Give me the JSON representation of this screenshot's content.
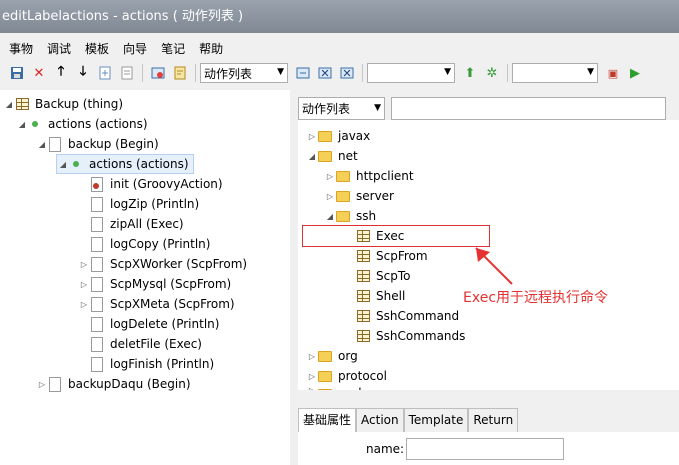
{
  "window": {
    "title": "editLabelactions - actions ( 动作列表 )"
  },
  "menu": [
    "事物",
    "调试",
    "模板",
    "向导",
    "笔记",
    "帮助"
  ],
  "toolbar": {
    "icons": [
      "save-icon",
      "delete-icon",
      "move-up-icon",
      "move-down-icon",
      "import-icon",
      "export-icon",
      "refresh-icon",
      "note-icon",
      "edit-icon",
      "remove-icon",
      "browse-icon",
      "run-icon",
      "debug-icon",
      "play-icon"
    ],
    "combo1_value": "动作列表",
    "combo2_value": "",
    "combo3_value": ""
  },
  "left_tree": [
    {
      "label": "Backup (thing)",
      "icon": "table-icon",
      "expanded": true
    },
    {
      "label": "actions (actions)",
      "icon": "status-dot-icon",
      "expanded": true
    },
    {
      "label": "backup (Begin)",
      "icon": "document-icon",
      "expanded": true
    },
    {
      "label": "actions (actions)",
      "icon": "status-dot-icon",
      "expanded": true,
      "selected": true
    },
    {
      "label": "init (GroovyAction)",
      "icon": "script-icon"
    },
    {
      "label": "logZip (Println)",
      "icon": "document-icon"
    },
    {
      "label": "zipAll (Exec)",
      "icon": "document-icon"
    },
    {
      "label": "logCopy (Println)",
      "icon": "document-icon"
    },
    {
      "label": "ScpXWorker (ScpFrom)",
      "icon": "document-icon",
      "expandable": true
    },
    {
      "label": "ScpMysql (ScpFrom)",
      "icon": "document-icon",
      "expandable": true
    },
    {
      "label": "ScpXMeta (ScpFrom)",
      "icon": "document-icon",
      "expandable": true
    },
    {
      "label": "logDelete (Println)",
      "icon": "document-icon"
    },
    {
      "label": "deletFile (Exec)",
      "icon": "document-icon"
    },
    {
      "label": "logFinish (Println)",
      "icon": "document-icon"
    },
    {
      "label": "backupDaqu (Begin)",
      "icon": "document-icon",
      "expandable": true
    }
  ],
  "right_panel": {
    "combo_value": "动作列表",
    "search_value": "",
    "tree": [
      {
        "label": "javax",
        "icon": "folder-icon",
        "expandable": true
      },
      {
        "label": "net",
        "icon": "folder-icon",
        "expanded": true
      },
      {
        "label": "httpclient",
        "icon": "folder-icon",
        "expandable": true
      },
      {
        "label": "server",
        "icon": "folder-icon",
        "expandable": true
      },
      {
        "label": "ssh",
        "icon": "folder-icon",
        "expanded": true
      },
      {
        "label": "Exec",
        "icon": "table-icon",
        "highlighted": true
      },
      {
        "label": "ScpFrom",
        "icon": "table-icon"
      },
      {
        "label": "ScpTo",
        "icon": "table-icon"
      },
      {
        "label": "Shell",
        "icon": "table-icon"
      },
      {
        "label": "SshCommand",
        "icon": "table-icon"
      },
      {
        "label": "SshCommands",
        "icon": "table-icon"
      },
      {
        "label": "org",
        "icon": "folder-icon",
        "expandable": true
      },
      {
        "label": "protocol",
        "icon": "folder-icon",
        "expandable": true
      },
      {
        "label": "scala",
        "icon": "folder-icon",
        "expandable": true
      }
    ],
    "tabs": [
      "基础属性",
      "Action",
      "Template",
      "Return"
    ],
    "active_tab": 0,
    "form": {
      "name_label": "name:",
      "name_value": ""
    }
  },
  "annotation": {
    "text": "Exec用于远程执行命令",
    "color": "#e53131"
  }
}
